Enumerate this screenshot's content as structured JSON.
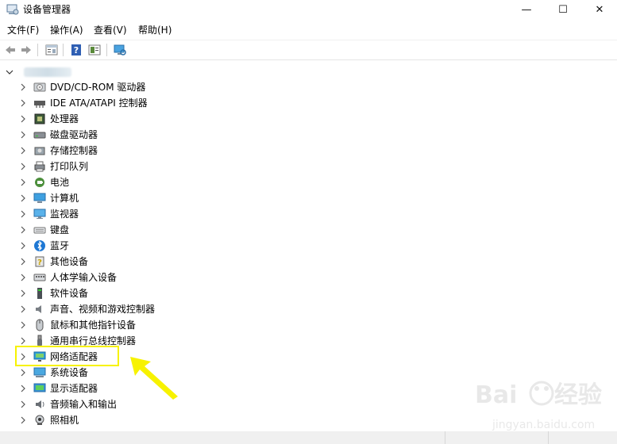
{
  "window": {
    "title": "设备管理器",
    "minimize_glyph": "—",
    "maximize_glyph": "☐",
    "close_glyph": "✕"
  },
  "menu": [
    {
      "label": "文件(F)"
    },
    {
      "label": "操作(A)"
    },
    {
      "label": "查看(V)"
    },
    {
      "label": "帮助(H)"
    }
  ],
  "toolbar": {
    "buttons": [
      "back-arrow-icon",
      "forward-arrow-icon",
      "properties-icon",
      "help-icon",
      "update-driver-icon",
      "monitor-scan-icon"
    ]
  },
  "tree": {
    "root_expanded": true,
    "nodes": [
      {
        "label": "DVD/CD-ROM 驱动器",
        "icon": "dvd-drive-icon"
      },
      {
        "label": "IDE ATA/ATAPI 控制器",
        "icon": "ide-controller-icon"
      },
      {
        "label": "处理器",
        "icon": "processor-icon"
      },
      {
        "label": "磁盘驱动器",
        "icon": "disk-drive-icon"
      },
      {
        "label": "存储控制器",
        "icon": "storage-controller-icon"
      },
      {
        "label": "打印队列",
        "icon": "printer-icon"
      },
      {
        "label": "电池",
        "icon": "battery-icon"
      },
      {
        "label": "计算机",
        "icon": "computer-icon"
      },
      {
        "label": "监视器",
        "icon": "monitor-icon"
      },
      {
        "label": "键盘",
        "icon": "keyboard-icon"
      },
      {
        "label": "蓝牙",
        "icon": "bluetooth-icon"
      },
      {
        "label": "其他设备",
        "icon": "other-devices-icon"
      },
      {
        "label": "人体学输入设备",
        "icon": "hid-icon"
      },
      {
        "label": "软件设备",
        "icon": "software-device-icon"
      },
      {
        "label": "声音、视频和游戏控制器",
        "icon": "sound-icon"
      },
      {
        "label": "鼠标和其他指针设备",
        "icon": "mouse-icon"
      },
      {
        "label": "通用串行总线控制器",
        "icon": "usb-icon"
      },
      {
        "label": "网络适配器",
        "icon": "network-adapter-icon"
      },
      {
        "label": "系统设备",
        "icon": "system-devices-icon"
      },
      {
        "label": "显示适配器",
        "icon": "display-adapter-icon"
      },
      {
        "label": "音频输入和输出",
        "icon": "audio-io-icon"
      },
      {
        "label": "照相机",
        "icon": "camera-icon"
      }
    ]
  },
  "highlight": {
    "target": "网络适配器",
    "color": "#f7f200"
  },
  "colors": {
    "accent_blue": "#2f7fd6",
    "highlight_yellow": "#f7f200"
  }
}
